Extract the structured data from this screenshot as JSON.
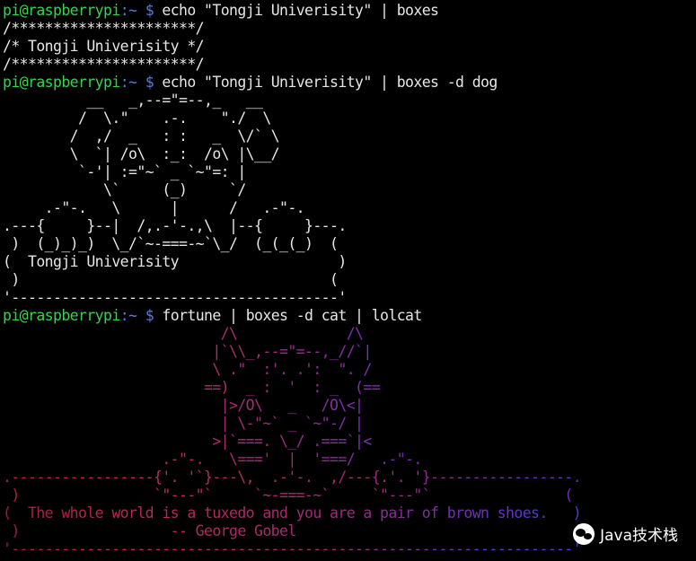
{
  "prompt": {
    "user_host": "pi@raspberrypi",
    "path_part": ":~ $ "
  },
  "commands": [
    "echo \"Tongji Univerisity\" | boxes",
    "echo \"Tongji Univerisity\" | boxes -d dog",
    "fortune | boxes -d cat | lolcat"
  ],
  "box_output": [
    "/**********************/",
    "/* Tongji Univerisity */",
    "/**********************/"
  ],
  "dog_output": [
    "          __   _,--=\"=--,_   __",
    "         /  \\.\"    .-.    \"./  \\",
    "        /  ,/  _   : :   _  \\/` \\",
    "        \\  `| /o\\  :_:  /o\\ |\\__/",
    "         `-'| :=\"~` _ `~\"=: |",
    "            \\`     (_)     `/",
    "     .-\"-.   \\      |      /   .-\"-.",
    ".---{     }--|  /,.-'-.,\\  |--{     }---.",
    " )  (_)_)_)  \\_/`~-===-~`\\_/  (_(_(_)  (",
    "(  Tongji Univerisity                   )",
    " )                                     (",
    "'---------------------------------------'"
  ],
  "cat_output": [
    "                          /\\             /\\",
    "                         |`\\\\_,--=\"=--,_//`|",
    "                         \\ .\"  :'. .':  \". /",
    "                        ==)  _ :  '  : _  (==",
    "                          |>/O\\   _   /O\\<|",
    "                          | \\-\"~` _ `~\"-/ |",
    "                         >|`===. \\_/ .===`|<",
    "                   .-\"-.   \\==='  |  '===/   .-\"-.",
    ".-----------------{'. '`}---\\,  .-'-.  ,/---{.'. '}-----------------.",
    " )                `\"---\"`     `~-===-~`     `\"---\"`                (",
    "(  The whole world is a tuxedo and you are a pair of brown shoes.   )",
    " )                  -- George Gobel                                 (",
    "'-------------------------------------------------------------------'"
  ],
  "watermark": {
    "text": "Java技术栈",
    "icon": "wechat-icon"
  },
  "colors": {
    "background": "#000000",
    "text": "#e6e6e6",
    "user_host": "#34d34a",
    "path": "#5b7bd8",
    "lolcat_start": "#b3214f",
    "lolcat_end": "#4a3fd0"
  }
}
